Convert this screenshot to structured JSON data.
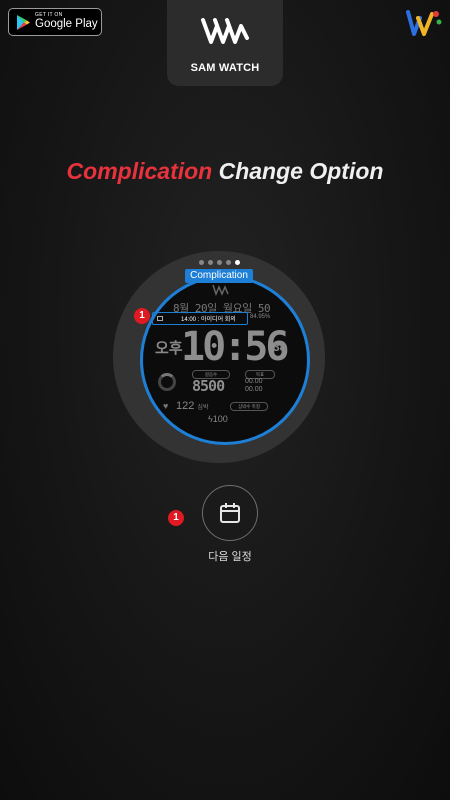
{
  "store_badge": {
    "small": "GET IT ON",
    "big": "Google Play"
  },
  "brand": {
    "name": "SAM WATCH"
  },
  "headline": {
    "red": "Complication",
    "white": "Change Option"
  },
  "watch": {
    "complication_label": "Complication",
    "date_line": "8월 20일 월요일 50",
    "complication_text": "14:00 : 아이디어 회의",
    "battery_small": "84.95%",
    "ampm": "오후",
    "time": "10:56",
    "seconds": "38",
    "steps_label": "걸음수",
    "steps": "8500",
    "other_label": "목표",
    "small_value_1": "00.00",
    "small_value_2": "00.00",
    "heart_rate": "122",
    "heart_unit": "심박",
    "misc_label": "심박수 측정",
    "energy": "100"
  },
  "badge_number": "1",
  "complication_button": {
    "icon": "calendar-icon",
    "caption": "다음 일정"
  },
  "colors": {
    "accent_blue": "#1e7fd6",
    "badge_red": "#e01a22",
    "headline_red": "#e8323c"
  }
}
